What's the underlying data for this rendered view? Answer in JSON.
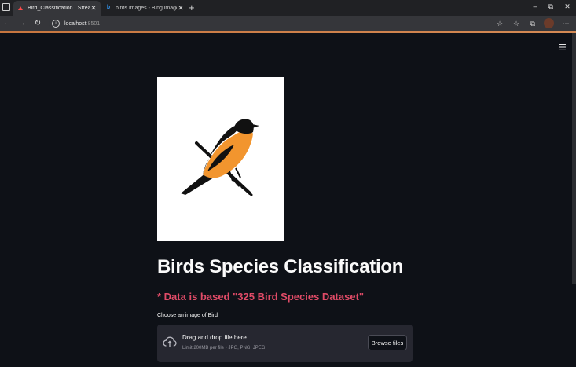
{
  "browser": {
    "tabs": [
      {
        "label": "Bird_Classification · Streamlit",
        "active": true,
        "favicon": "streamlit-icon"
      },
      {
        "label": "birds images - Bing images",
        "active": false,
        "favicon": "bing-icon"
      }
    ],
    "new_tab_symbol": "+",
    "window_controls": {
      "minimize": "–",
      "restore": "⧉",
      "close": "✕"
    },
    "address": {
      "host": "localhost",
      "port": ":8501"
    },
    "nav": {
      "back": "←",
      "forward": "→",
      "reload": "↻"
    },
    "toolbar_symbols": {
      "reading": "☆",
      "favorites": "☆",
      "collections": "⧉",
      "more": "⋯"
    },
    "tab_close": "✕"
  },
  "app": {
    "menu_symbol": "☰",
    "image_subject": "bird-illustration",
    "title": "Birds Species Classification",
    "subtitle": "* Data is based \"325 Bird Species Dataset\"",
    "uploader": {
      "label": "Choose an image of Bird",
      "drop_title": "Drag and drop file here",
      "drop_limits": "Limit 200MB per file • JPG, PNG, JPEG",
      "browse_label": "Browse files"
    }
  },
  "colors": {
    "background": "#0e1117",
    "subtitle": "#e04b67",
    "dropzone": "#262730",
    "bird_body": "#111111",
    "bird_wing": "#f2952e"
  }
}
